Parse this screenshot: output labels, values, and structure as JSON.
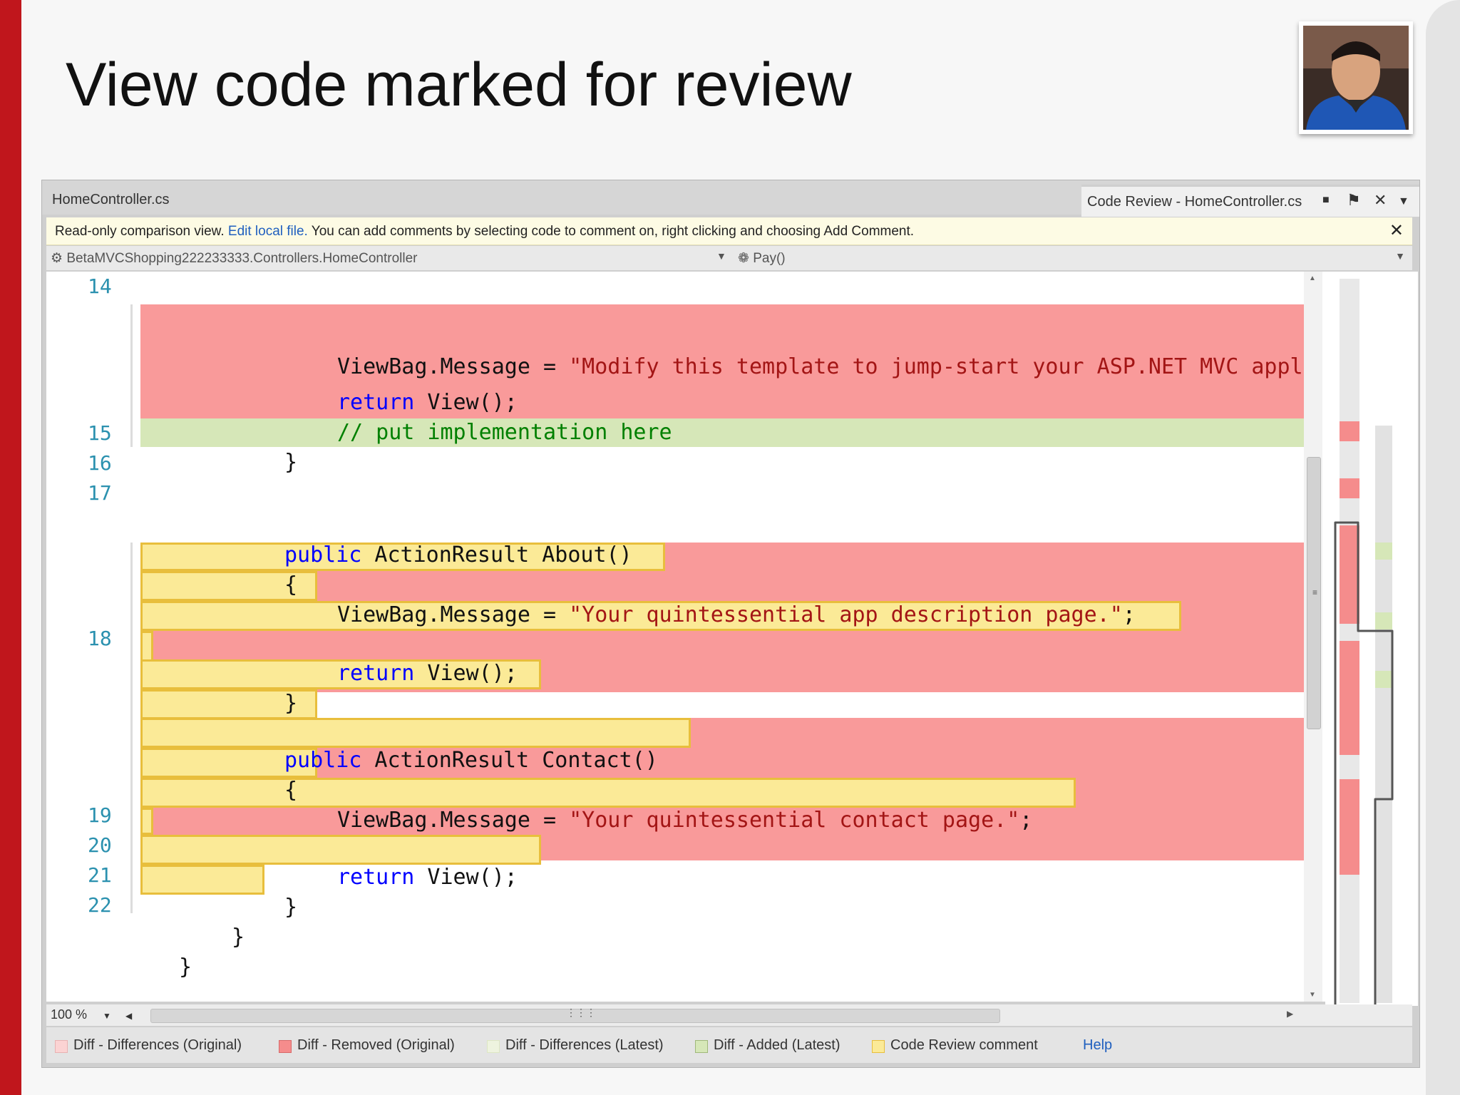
{
  "slide": {
    "title": "View code marked for review"
  },
  "ide": {
    "file_tab": "HomeController.cs",
    "review_tab": "Code Review - HomeController.cs",
    "infobar": {
      "text_before": "Read-only comparison view. ",
      "link": "Edit local file.",
      "text_after": " You can add comments by selecting code to comment on, right clicking and choosing Add Comment."
    },
    "navbar": {
      "class_path": "BetaMVCShopping222233333.Controllers.HomeController",
      "method": "Pay()"
    },
    "line_numbers": [
      "14",
      "15",
      "16",
      "17",
      "18",
      "19",
      "20",
      "21",
      "22"
    ],
    "code": {
      "viewbag_modify": "ViewBag.Message = ",
      "modify_string": "\"Modify this template to jump-start your ASP.NET MVC appli",
      "return_kw": "return",
      "return_view": " View();",
      "comment": "// put implementation here",
      "close_brace": "}",
      "open_brace": "{",
      "public_kw": "public",
      "about_sig": " ActionResult About()",
      "about_string": "\"Your quintessential app description page.\"",
      "contact_sig": " ActionResult Contact()",
      "contact_string": "\"Your quintessential contact page.\"",
      "semicolon": ";"
    },
    "zoom": "100 %",
    "legend": [
      {
        "label": "Diff - Differences (Original)",
        "color": "#fbd3d3"
      },
      {
        "label": "Diff - Removed (Original)",
        "color": "#f58c8c"
      },
      {
        "label": "Diff - Differences (Latest)",
        "color": "#eef3df"
      },
      {
        "label": "Diff - Added (Latest)",
        "color": "#d6e7b8"
      },
      {
        "label": "Code Review comment",
        "color": "#fbea97"
      }
    ],
    "help": "Help"
  },
  "colors": {
    "accent_red": "#c0161c",
    "removed": "#f99a9a",
    "added": "#d6e7b8",
    "review_comment": "#fbea97",
    "link": "#1f5fbf"
  }
}
